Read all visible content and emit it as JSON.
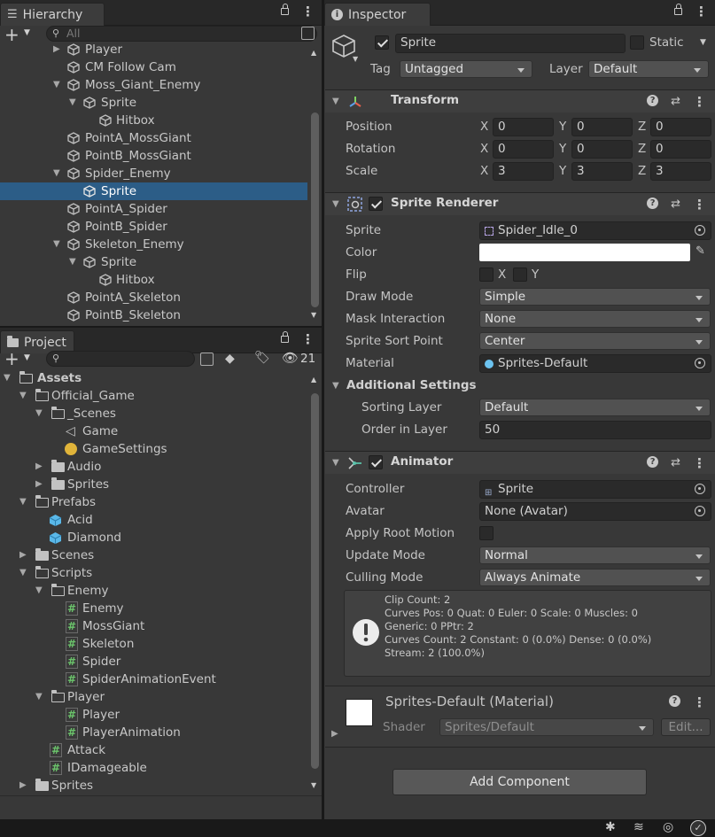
{
  "hierarchy": {
    "tab_title": "Hierarchy",
    "search_placeholder": "All",
    "items": [
      {
        "label": "Player"
      },
      {
        "label": "CM Follow Cam"
      },
      {
        "label": "Moss_Giant_Enemy"
      },
      {
        "label": "Sprite"
      },
      {
        "label": "Hitbox"
      },
      {
        "label": "PointA_MossGiant"
      },
      {
        "label": "PointB_MossGiant"
      },
      {
        "label": "Spider_Enemy"
      },
      {
        "label": "Sprite",
        "selected": true
      },
      {
        "label": "PointA_Spider"
      },
      {
        "label": "PointB_Spider"
      },
      {
        "label": "Skeleton_Enemy"
      },
      {
        "label": "Sprite"
      },
      {
        "label": "Hitbox"
      },
      {
        "label": "PointA_Skeleton"
      },
      {
        "label": "PointB_Skeleton"
      }
    ]
  },
  "project": {
    "tab_title": "Project",
    "hidden_count": "21",
    "items": [
      {
        "label": "Assets"
      },
      {
        "label": "Official_Game"
      },
      {
        "label": "_Scenes"
      },
      {
        "label": "Game"
      },
      {
        "label": "GameSettings"
      },
      {
        "label": "Audio"
      },
      {
        "label": "Sprites"
      },
      {
        "label": "Prefabs"
      },
      {
        "label": "Acid"
      },
      {
        "label": "Diamond"
      },
      {
        "label": "Scenes"
      },
      {
        "label": "Scripts"
      },
      {
        "label": "Enemy"
      },
      {
        "label": "Enemy"
      },
      {
        "label": "MossGiant"
      },
      {
        "label": "Skeleton"
      },
      {
        "label": "Spider"
      },
      {
        "label": "SpiderAnimationEvent"
      },
      {
        "label": "Player"
      },
      {
        "label": "Player"
      },
      {
        "label": "PlayerAnimation"
      },
      {
        "label": "Attack"
      },
      {
        "label": "IDamageable"
      },
      {
        "label": "Sprites"
      }
    ]
  },
  "inspector": {
    "tab_title": "Inspector",
    "object_name": "Sprite",
    "static_label": "Static",
    "tag_label": "Tag",
    "tag_value": "Untagged",
    "layer_label": "Layer",
    "layer_value": "Default",
    "transform": {
      "title": "Transform",
      "position_label": "Position",
      "rotation_label": "Rotation",
      "scale_label": "Scale",
      "position": [
        "0",
        "0",
        "0"
      ],
      "rotation": [
        "0",
        "0",
        "0"
      ],
      "scale": [
        "3",
        "3",
        "3"
      ]
    },
    "sprite_renderer": {
      "title": "Sprite Renderer",
      "sprite_label": "Sprite",
      "sprite_value": "Spider_Idle_0",
      "color_label": "Color",
      "color_value": "#ffffff",
      "flip_label": "Flip",
      "flip_x": "X",
      "flip_y": "Y",
      "draw_mode_label": "Draw Mode",
      "draw_mode_value": "Simple",
      "mask_label": "Mask Interaction",
      "mask_value": "None",
      "sort_point_label": "Sprite Sort Point",
      "sort_point_value": "Center",
      "material_label": "Material",
      "material_value": "Sprites-Default",
      "additional_label": "Additional Settings",
      "sorting_layer_label": "Sorting Layer",
      "sorting_layer_value": "Default",
      "order_label": "Order in Layer",
      "order_value": "50"
    },
    "animator": {
      "title": "Animator",
      "controller_label": "Controller",
      "controller_value": "Sprite",
      "avatar_label": "Avatar",
      "avatar_value": "None (Avatar)",
      "root_motion_label": "Apply Root Motion",
      "update_mode_label": "Update Mode",
      "update_mode_value": "Normal",
      "culling_label": "Culling Mode",
      "culling_value": "Always Animate",
      "info_lines": [
        "Clip Count: 2",
        "Curves Pos: 0 Quat: 0 Euler: 0 Scale: 0 Muscles: 0",
        "Generic: 0 PPtr: 2",
        "Curves Count: 2 Constant: 0 (0.0%) Dense: 0 (0.0%)",
        "Stream: 2 (100.0%)"
      ]
    },
    "material": {
      "title": "Sprites-Default (Material)",
      "shader_label": "Shader",
      "shader_value": "Sprites/Default",
      "edit_label": "Edit..."
    },
    "add_component_label": "Add Component"
  },
  "colors": {
    "selection": "#2c5d87",
    "panel": "#383838",
    "header": "#3e3e3e"
  }
}
